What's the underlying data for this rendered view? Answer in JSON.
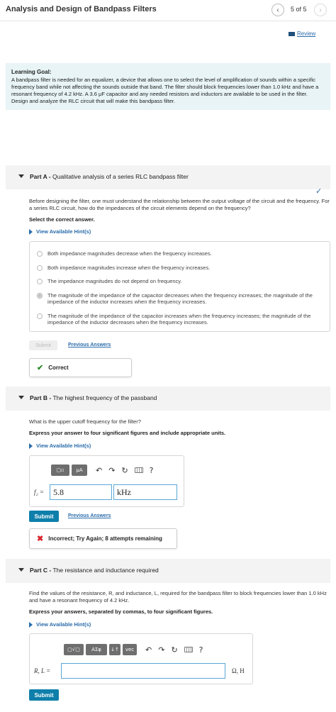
{
  "header": {
    "title": "Analysis and Design of Bandpass Filters",
    "prev": "‹",
    "page_count": "5 of 5",
    "next": "›"
  },
  "review": {
    "label": "Review"
  },
  "learning_goal": {
    "title": "Learning Goal:",
    "text": "A bandpass filter is needed for an equalizer, a device that allows one to select the level of amplification of sounds within a specific frequency band while not affecting the sounds outside that band. The filter should block frequencies lower than 1.0 kHz and have a resonant frequency of 4.2 kHz. A 3.6 μF capacitor and any needed resistors and inductors are available to be used in the filter. Design and analyze the RLC circuit that will make this bandpass filter."
  },
  "part_a": {
    "label": "Part A -",
    "title": "Qualitative analysis of a series RLC bandpass filter",
    "status": "✓",
    "question": "Before designing the filter, one must understand the relationship between the output voltage of the circuit and the frequency. For a series RLC circuit, how do the impedances of the circuit elements depend on the frequency?",
    "instruction": "Select the correct answer.",
    "hints": "View Available Hint(s)",
    "options": [
      "Both impedance magnitudes decrease when the frequency increases.",
      "Both impedance magnitudes increase when the frequency increases.",
      "The impedance magnitudes do not depend on frequency.",
      "The magnitude of the impedance of the capacitor decreases when the frequency increases; the magnitude of the impedance of the inductor increases when the frequency increases.",
      "The magnitude of the impedance of the capacitor increases when the frequency increases; the magnitude of the impedance of the inductor decreases when the frequency increases."
    ],
    "selected_index": 3,
    "submit": "Submit",
    "previous_answers": "Previous Answers",
    "feedback": "Correct",
    "feedback_mark": "✔"
  },
  "part_b": {
    "label": "Part B -",
    "title": "The highest frequency of the passband",
    "question": "What is the upper cutoff frequency for the filter?",
    "instruction": "Express your answer to four significant figures and include appropriate units.",
    "hints": "View Available Hint(s)",
    "toolbar": {
      "templates": "▢▫",
      "units": "μA",
      "undo": "↶",
      "redo": "↷",
      "reset": "↻",
      "help": "?"
    },
    "variable": "f₂ =",
    "value": "5.8",
    "unit": "kHz",
    "submit": "Submit",
    "previous_answers": "Previous Answers",
    "feedback": "Incorrect; Try Again; 8 attempts remaining",
    "feedback_mark": "✖"
  },
  "part_c": {
    "label": "Part C -",
    "title": "The resistance and inductance required",
    "question": "Find the values of the resistance, R, and inductance, L, required for the bandpass filter to block frequencies lower than 1.0 kHz and have a resonant frequency of 4.2 kHz.",
    "instruction": "Express your answers, separated by commas, to four significant figures.",
    "hints": "View Available Hint(s)",
    "toolbar": {
      "templates": "▢√▢",
      "greek": "ΑΣφ",
      "arrows": "↓↑",
      "vec": "vec",
      "undo": "↶",
      "redo": "↷",
      "reset": "↻",
      "help": "?"
    },
    "variable": "R, L =",
    "value": "",
    "unit": "Ω, H",
    "submit": "Submit"
  },
  "colors": {
    "accent": "#2a6cab",
    "submit_bg": "#0e7faa",
    "goal_bg": "#e8f4f6",
    "correct": "#2e8b2e",
    "incorrect": "#d9262c"
  }
}
